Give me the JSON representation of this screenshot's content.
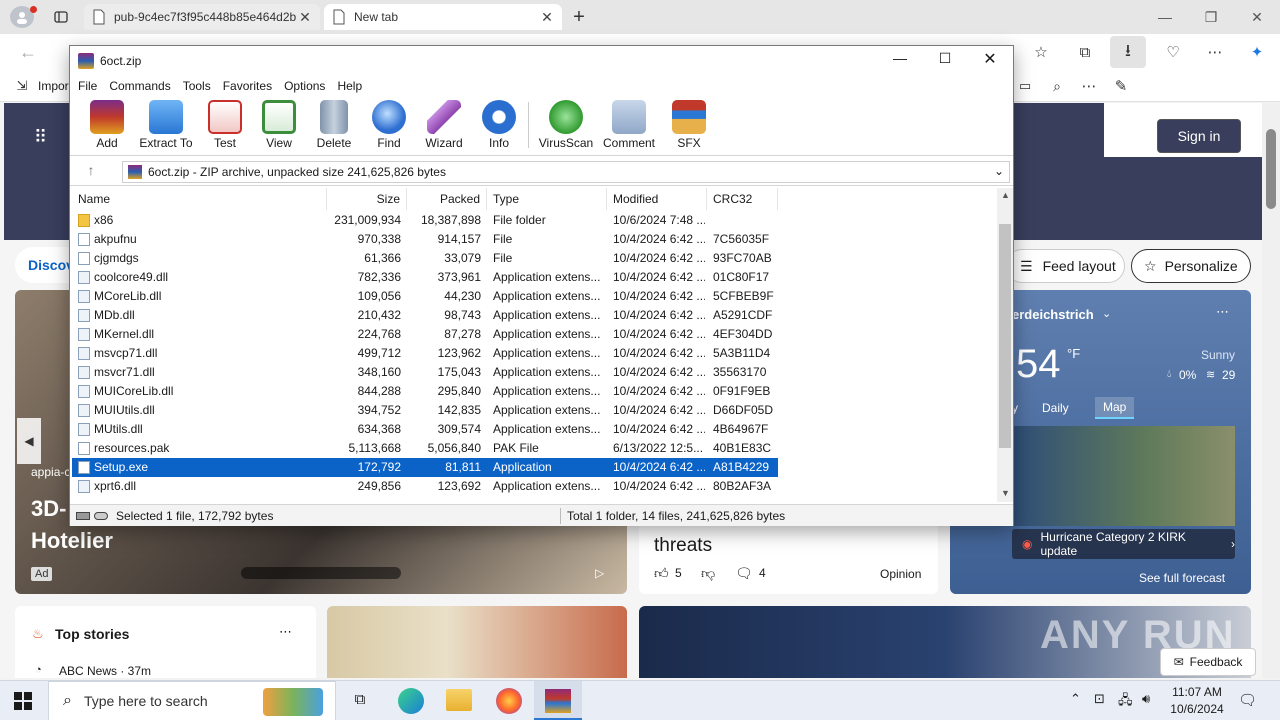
{
  "browser": {
    "tabs": [
      {
        "title": "pub-9c4ec7f3f95c448b85e464d2b"
      },
      {
        "title": "New tab"
      }
    ],
    "favbar": {
      "first_item": "Impor"
    }
  },
  "page": {
    "signin": "Sign in",
    "discover": "Discov",
    "feed_layout": "Feed layout",
    "personalize": "Personalize",
    "weather": {
      "location": "erdeichstrich",
      "temp": "54",
      "unit": "°F",
      "condition": "Sunny",
      "precip": "0%",
      "wind": "29",
      "tab_daily": "Daily",
      "tab_map": "Map",
      "tab_partial": "y",
      "alert": "Hurricane Category 2 KIRK update",
      "forecast_link": "See full forecast"
    },
    "hero": {
      "source": "appia-c",
      "title1": "3D-",
      "title2": "Hotelier",
      "ad": "Ad"
    },
    "mid_story": {
      "title_partial": "threats",
      "likes": "5",
      "comments": "4",
      "tag": "Opinion"
    },
    "top_stories": {
      "title": "Top stories",
      "source": "ABC News · 37m"
    },
    "feedback": "Feedback",
    "watermark": "ANY RUN"
  },
  "winrar": {
    "title": "6oct.zip",
    "menu": [
      "File",
      "Commands",
      "Tools",
      "Favorites",
      "Options",
      "Help"
    ],
    "toolbar": [
      {
        "label": "Add",
        "icon": "add-icon",
        "color": "#c0392b"
      },
      {
        "label": "Extract To",
        "icon": "extract-icon",
        "color": "#3a8ee6"
      },
      {
        "label": "Test",
        "icon": "test-icon",
        "color": "#d9534f"
      },
      {
        "label": "View",
        "icon": "view-icon",
        "color": "#3c8d3c"
      },
      {
        "label": "Delete",
        "icon": "delete-icon",
        "color": "#8a9bb0"
      },
      {
        "label": "Find",
        "icon": "find-icon",
        "color": "#2f6fd1"
      },
      {
        "label": "Wizard",
        "icon": "wizard-icon",
        "color": "#8e44ad"
      },
      {
        "label": "Info",
        "icon": "info-icon",
        "color": "#2a6fcf"
      },
      {
        "label": "VirusScan",
        "icon": "virusscan-icon",
        "color": "#3aa63a"
      },
      {
        "label": "Comment",
        "icon": "comment-icon",
        "color": "#8fa7c7"
      },
      {
        "label": "SFX",
        "icon": "sfx-icon",
        "color": "#e08a2c"
      }
    ],
    "path": "6oct.zip - ZIP archive, unpacked size 241,625,826 bytes",
    "columns": [
      "Name",
      "Size",
      "Packed",
      "Type",
      "Modified",
      "CRC32"
    ],
    "files": [
      {
        "name": "x86",
        "size": "231,009,934",
        "packed": "18,387,898",
        "type": "File folder",
        "modified": "10/6/2024 7:48 ...",
        "crc": "",
        "kind": "folder"
      },
      {
        "name": "akpufnu",
        "size": "970,338",
        "packed": "914,157",
        "type": "File",
        "modified": "10/4/2024 6:42 ...",
        "crc": "7C56035F",
        "kind": "file"
      },
      {
        "name": "cjgmdgs",
        "size": "61,366",
        "packed": "33,079",
        "type": "File",
        "modified": "10/4/2024 6:42 ...",
        "crc": "93FC70AB",
        "kind": "file"
      },
      {
        "name": "coolcore49.dll",
        "size": "782,336",
        "packed": "373,961",
        "type": "Application extens...",
        "modified": "10/4/2024 6:42 ...",
        "crc": "01C80F17",
        "kind": "dll"
      },
      {
        "name": "MCoreLib.dll",
        "size": "109,056",
        "packed": "44,230",
        "type": "Application extens...",
        "modified": "10/4/2024 6:42 ...",
        "crc": "5CFBEB9F",
        "kind": "dll"
      },
      {
        "name": "MDb.dll",
        "size": "210,432",
        "packed": "98,743",
        "type": "Application extens...",
        "modified": "10/4/2024 6:42 ...",
        "crc": "A5291CDF",
        "kind": "dll"
      },
      {
        "name": "MKernel.dll",
        "size": "224,768",
        "packed": "87,278",
        "type": "Application extens...",
        "modified": "10/4/2024 6:42 ...",
        "crc": "4EF304DD",
        "kind": "dll"
      },
      {
        "name": "msvcp71.dll",
        "size": "499,712",
        "packed": "123,962",
        "type": "Application extens...",
        "modified": "10/4/2024 6:42 ...",
        "crc": "5A3B11D4",
        "kind": "dll"
      },
      {
        "name": "msvcr71.dll",
        "size": "348,160",
        "packed": "175,043",
        "type": "Application extens...",
        "modified": "10/4/2024 6:42 ...",
        "crc": "35563170",
        "kind": "dll"
      },
      {
        "name": "MUICoreLib.dll",
        "size": "844,288",
        "packed": "295,840",
        "type": "Application extens...",
        "modified": "10/4/2024 6:42 ...",
        "crc": "0F91F9EB",
        "kind": "dll"
      },
      {
        "name": "MUIUtils.dll",
        "size": "394,752",
        "packed": "142,835",
        "type": "Application extens...",
        "modified": "10/4/2024 6:42 ...",
        "crc": "D66DF05D",
        "kind": "dll"
      },
      {
        "name": "MUtils.dll",
        "size": "634,368",
        "packed": "309,574",
        "type": "Application extens...",
        "modified": "10/4/2024 6:42 ...",
        "crc": "4B64967F",
        "kind": "dll"
      },
      {
        "name": "resources.pak",
        "size": "5,113,668",
        "packed": "5,056,840",
        "type": "PAK File",
        "modified": "6/13/2022 12:5...",
        "crc": "40B1E83C",
        "kind": "file"
      },
      {
        "name": "Setup.exe",
        "size": "172,792",
        "packed": "81,811",
        "type": "Application",
        "modified": "10/4/2024 6:42 ...",
        "crc": "A81B4229",
        "kind": "exe",
        "selected": true
      },
      {
        "name": "xprt6.dll",
        "size": "249,856",
        "packed": "123,692",
        "type": "Application extens...",
        "modified": "10/4/2024 6:42 ...",
        "crc": "80B2AF3A",
        "kind": "dll"
      }
    ],
    "status_left": "Selected 1 file, 172,792 bytes",
    "status_right": "Total 1 folder, 14 files, 241,625,826 bytes"
  },
  "taskbar": {
    "search_placeholder": "Type here to search",
    "time": "11:07 AM",
    "date": "10/6/2024"
  }
}
